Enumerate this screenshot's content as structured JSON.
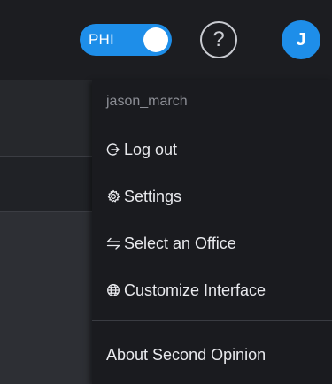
{
  "header": {
    "phi_toggle_label": "PHI",
    "phi_toggle_on": true,
    "help_icon": "question-circle-icon",
    "help_glyph": "?",
    "avatar_initial": "J"
  },
  "menu": {
    "username": "jason_march",
    "items": [
      {
        "label": "Log out",
        "icon": "logout-icon"
      },
      {
        "label": "Settings",
        "icon": "gear-icon"
      },
      {
        "label": "Select an Office",
        "icon": "swap-arrows-icon"
      },
      {
        "label": "Customize Interface",
        "icon": "globe-icon"
      }
    ],
    "about_label": "About Second Opinion"
  },
  "colors": {
    "accent": "#1e8ee9",
    "menu_background": "#1a1b1f",
    "topbar_background": "#1c1d21",
    "menu_text": "#e9eaee",
    "muted_text": "#8c8e95"
  }
}
